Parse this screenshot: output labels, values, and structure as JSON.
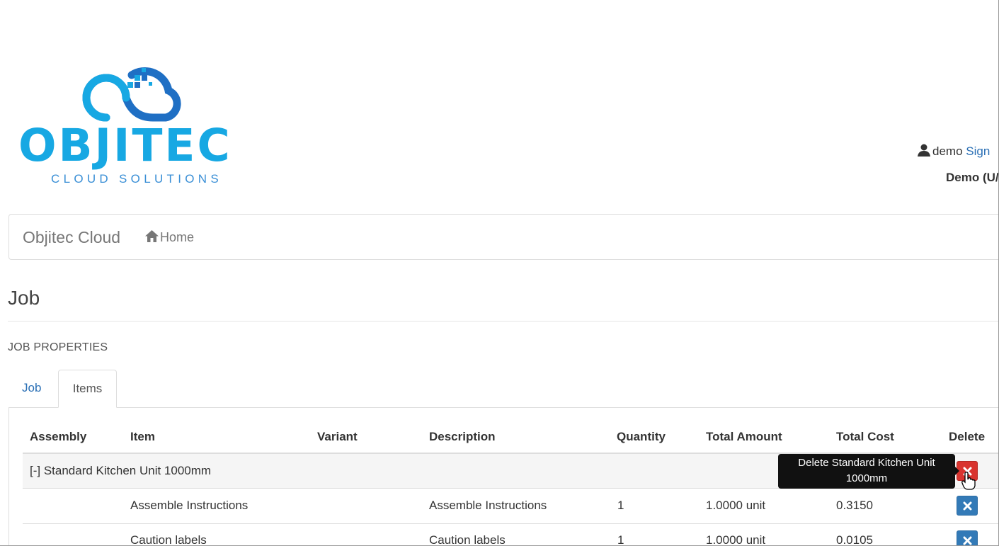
{
  "logo": {
    "wordmark": "OBJITEC",
    "tagline": "CLOUD SOLUTIONS",
    "brand_color": "#17a8e3"
  },
  "user": {
    "icon": "user-icon",
    "username": "demo",
    "signout_label": "Sign",
    "tenant": "Demo (U/"
  },
  "navbar": {
    "brand": "Objitec Cloud",
    "home_icon": "home-icon",
    "home_label": "Home"
  },
  "page": {
    "title": "Job",
    "section": "JOB PROPERTIES"
  },
  "tabs": [
    {
      "label": "Job",
      "active": false
    },
    {
      "label": "Items",
      "active": true
    }
  ],
  "table": {
    "headers": {
      "assembly": "Assembly",
      "item": "Item",
      "variant": "Variant",
      "description": "Description",
      "quantity": "Quantity",
      "total_amount": "Total Amount",
      "total_cost": "Total Cost",
      "delete": "Delete"
    },
    "group": {
      "label": "[-] Standard Kitchen Unit 1000mm",
      "delete_icon": "close-icon"
    },
    "rows": [
      {
        "item": "Assemble Instructions",
        "variant": "",
        "description": "Assemble Instructions",
        "quantity": "1",
        "total_amount": "1.0000 unit",
        "total_cost": "0.3150"
      },
      {
        "item": "Caution labels",
        "variant": "",
        "description": "Caution labels",
        "quantity": "1",
        "total_amount": "1.0000 unit",
        "total_cost": "0.0105"
      }
    ]
  },
  "tooltip": {
    "line1": "Delete Standard Kitchen Unit",
    "line2": "1000mm"
  },
  "colors": {
    "link": "#2a6fb5",
    "danger": "#d9342f",
    "primary": "#337ab7"
  }
}
